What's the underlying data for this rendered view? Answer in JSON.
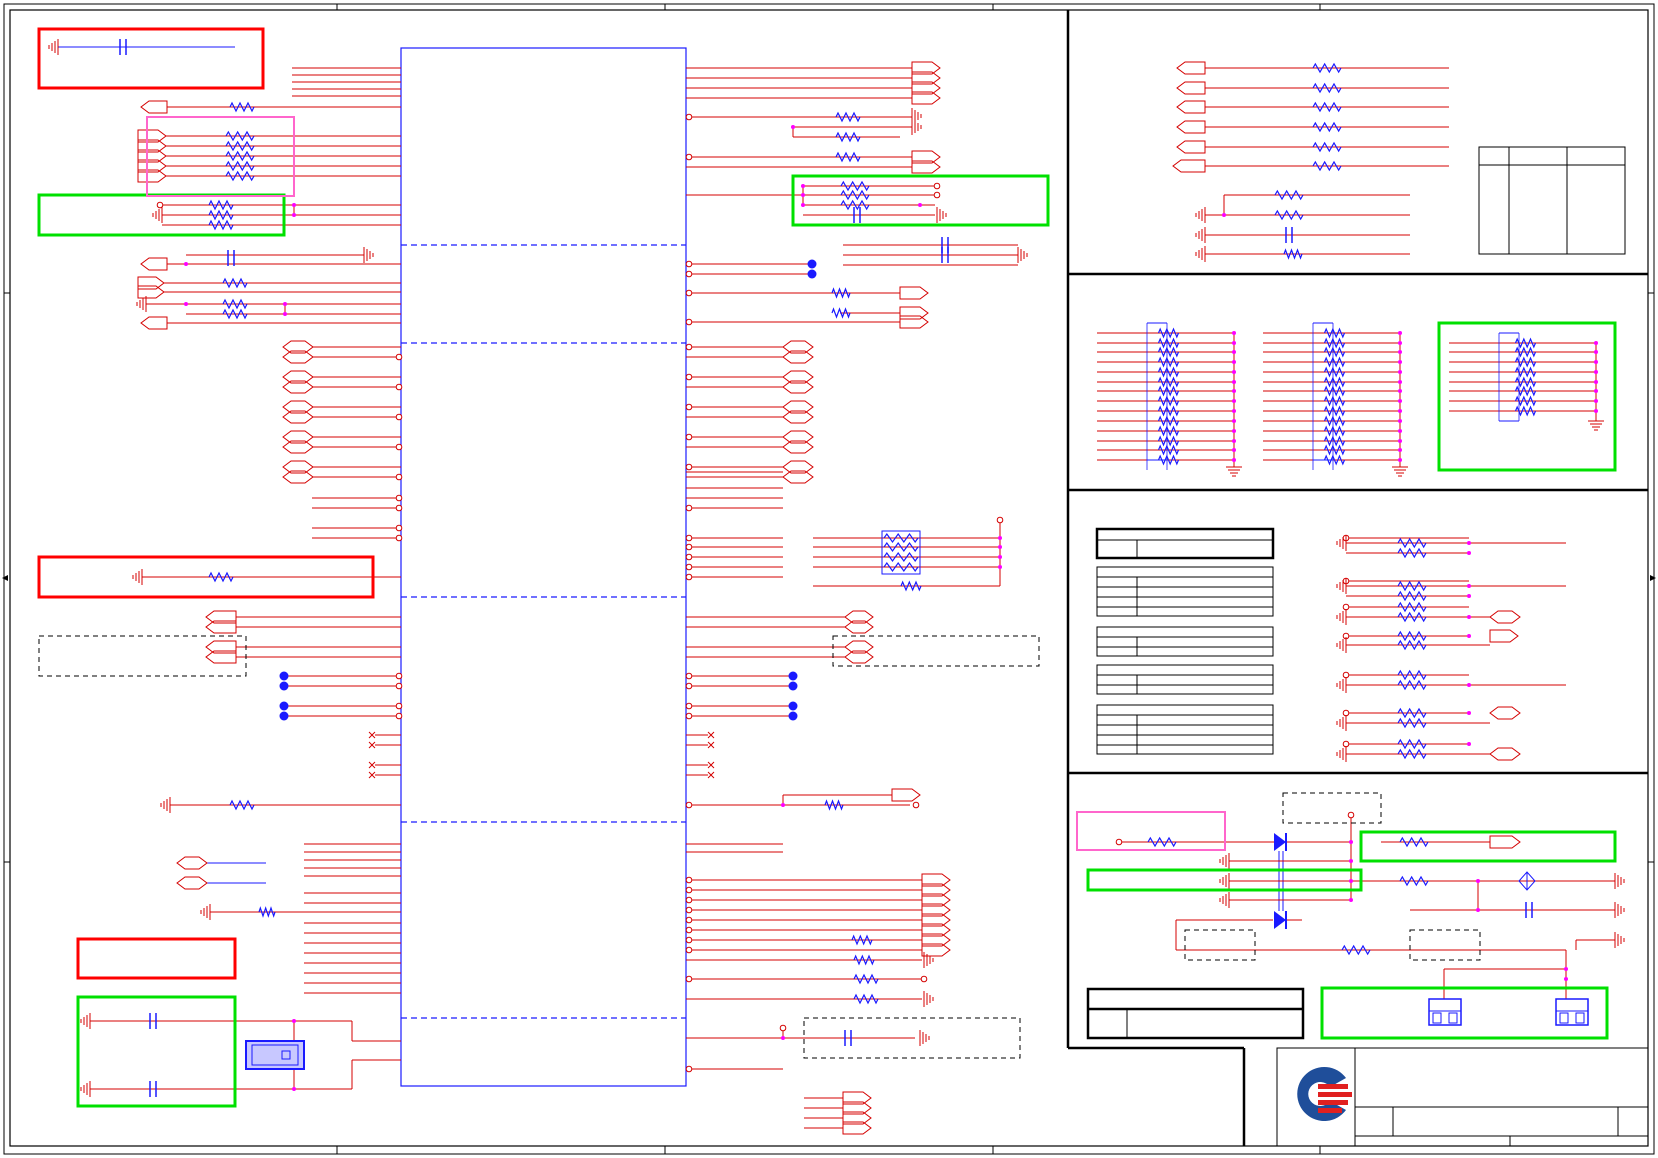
{
  "sheet": {
    "description_visible_text": "",
    "title_block": {
      "rows": [
        "",
        "",
        ""
      ]
    }
  },
  "colors": {
    "wire": "#d40000",
    "part": "#1a1aff",
    "frame": "#000000",
    "box_red": "#ff0000",
    "box_green": "#00e000",
    "box_pink": "#ff66cc",
    "junction": "#ff00ff",
    "logo_blue": "#1f4e9a",
    "logo_red": "#e02020"
  },
  "regions": {
    "main_ic": "main-ic-block",
    "top_right_panel": "resistor-panel",
    "middle_right_panel": "resistor-network-panel",
    "lower_right_panel": "strap-table-panel",
    "bottom_right_panel": "power-panel",
    "title_block": "title-block"
  },
  "icons": [
    "ground-icon",
    "resistor-icon",
    "capacitor-icon",
    "connector-icon",
    "diode-icon",
    "crystal-icon",
    "logo-icon"
  ]
}
